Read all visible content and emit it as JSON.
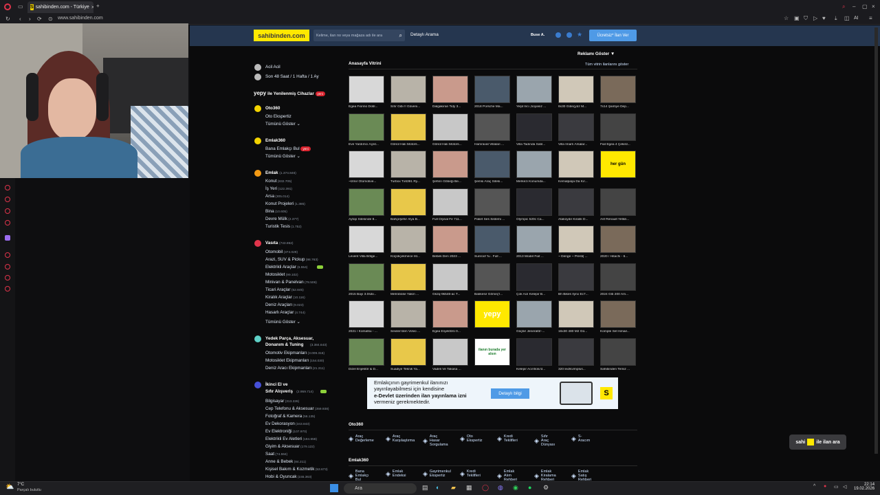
{
  "browser": {
    "tab_title": "sahibinden.com - Türkiye",
    "url": "www.sahibinden.com",
    "right_label": "AI"
  },
  "header": {
    "logo": "sahibinden.com",
    "search_placeholder": "Kelime, ilan no veya mağaza adı ile ara",
    "detailed_search": "Detaylı Arama",
    "user": "Buse A.",
    "post_ad": "Ücretsiz* İlan Ver"
  },
  "sidebar": {
    "acil": "Acil Acil",
    "son48": "Son 48 Saat",
    "haftalik": "1 Hafta",
    "aylik": "1 Ay",
    "yepy": "yepy",
    "yepy_text": "ile Yenilenmiş Cihazlar",
    "new_badge": "yeni",
    "oto360": "Oto360",
    "oto_ekspertiz": "Oto Ekspertiz",
    "tumunu": "Tümünü Göster",
    "emlak360": "Emlak360",
    "bana_emlakci": "Bana Emlakçı Bul",
    "emlak": {
      "title": "Emlak",
      "count": "(1.374.846)",
      "items": [
        {
          "n": "Konut",
          "c": "(832.705)"
        },
        {
          "n": "İş Yeri",
          "c": "(122.391)"
        },
        {
          "n": "Arsa",
          "c": "(305.014)"
        },
        {
          "n": "Konut Projeleri",
          "c": "(1.385)"
        },
        {
          "n": "Bina",
          "c": "(10.605)"
        },
        {
          "n": "Devre Mülk",
          "c": "(2.377)"
        },
        {
          "n": "Turistik Tesis",
          "c": "(1.752)"
        }
      ]
    },
    "vasita": {
      "title": "Vasıta",
      "count": "(743.862)",
      "items": [
        {
          "n": "Otomobil",
          "c": "(374.029)"
        },
        {
          "n": "Arazi, SUV & Pickup",
          "c": "(98.763)"
        },
        {
          "n": "Elektrikli Araçlar",
          "c": "(6.554)"
        },
        {
          "n": "Motosiklet",
          "c": "(99.102)"
        },
        {
          "n": "Minivan & Panelvan",
          "c": "(78.506)"
        },
        {
          "n": "Ticari Araçlar",
          "c": "(52.845)"
        },
        {
          "n": "Kiralık Araçlar",
          "c": "(10.116)"
        },
        {
          "n": "Deniz Araçları",
          "c": "(9.023)"
        },
        {
          "n": "Hasarlı Araçlar",
          "c": "(4.744)"
        }
      ]
    },
    "yedek": {
      "title": "Yedek Parça, Aksesuar, Donanım & Tuning",
      "count": "(3.384.643)",
      "items": [
        {
          "n": "Otomotiv Ekipmanları",
          "c": "(3.009.316)"
        },
        {
          "n": "Motosiklet Ekipmanları",
          "c": "(154.030)"
        },
        {
          "n": "Deniz Aracı Ekipmanları",
          "c": "(21.311)"
        }
      ]
    },
    "ikinci": {
      "title": "İkinci El ve",
      "title2": "Sıfır Alışveriş",
      "count": "(2.959.714)",
      "items": [
        {
          "n": "Bilgisayar",
          "c": "(313.226)"
        },
        {
          "n": "Cep Telefonu & Aksesuar",
          "c": "(359.938)"
        },
        {
          "n": "Fotoğraf & Kamera",
          "c": "(56.135)"
        },
        {
          "n": "Ev Dekorasyon",
          "c": "(343.843)"
        },
        {
          "n": "Ev Elektroniği",
          "c": "(107.970)"
        },
        {
          "n": "Elektrikli Ev Aletleri",
          "c": "(194.658)"
        },
        {
          "n": "Giyim & Aksesuar",
          "c": "(179.122)"
        },
        {
          "n": "Saat",
          "c": "(74.594)"
        },
        {
          "n": "Anne & Bebek",
          "c": "(84.211)"
        },
        {
          "n": "Kişisel Bakım & Kozmetik",
          "c": "(53.673)"
        },
        {
          "n": "Hobi & Oyuncak",
          "c": "(155.363)"
        }
      ]
    }
  },
  "showcase": {
    "ads_toggle": "Reklamı Göster ▼",
    "title": "Anasayfa Vitrini",
    "all_link": "Tüm vitrin ilanlarını göster",
    "items": [
      "Egea Fiorino Dobl...",
      "Sıfır Gibi !! Güveni...",
      "Dalgakıran Tidy 3...",
      "2018 Porsche Ma...",
      "Yeşil İnci ,boyasız ...",
      "8x30 Güleçyüz M...",
      "7x14 Şantiye Dep...",
      "Eve Yardımcı Açıkl...",
      "Gönül Halı Motors...",
      "Gönül Halı Motors...",
      "Hamravat Villaları ...",
      "Villa Tadında Satıl...",
      "Villa İmarlı Arsalar...",
      "Fiat Egea 4 Çekird...",
      "~Izmir Otomotive...",
      "Turbox Tx6391 Ry...",
      "Şehrin Göbeği Be...",
      "Şemsi Araç Sitesi...",
      "Merkezi Konumda...",
      "Kemalpaşa Da Kır...",
      "",
      "Aytop Sitesinde 8...",
      "Bahçeşehir Alya B...",
      "Full Orjinal Fe 711...",
      "Paket Ses Sistemi ...",
      "Olympic 520c Ca...",
      "Atakoyde Kiralık D...",
      "Asf Renault Yetkili...",
      "Levent Villa Bölge...",
      "Küçükçekmece İst...",
      "Bebek Den 2023 ...",
      "Sunroof 'lu . Full ...",
      "2013 Model Fiat ...",
      "~ Denge ~ Presti| ...",
      "2020 / Hitachi - 6...",
      "2015 Bayi 3.0sdv...",
      "Metrobüse Yakın ...",
      "Gk2q-9k546-ac T...",
      "Balıkesir Gömeç'l...",
      "Çok Acil Kelepir B...",
      "Bh Bikes Ilynx Ec7...",
      "2024 Glb 200 Am...",
      "2021 / Komatsu - ...",
      "Sevilen'den Volvo ...",
      "Egea Enjektörü 0...",
      "",
      "Güçbir Jeneratör-...",
      "16x30 480 M2 Gü...",
      "Komple Set İsmail...",
      "Dizel Enjektör & D...",
      "Suadiye Teknik Ya...",
      "Vadeli Ve Takasa ...",
      "",
      "Kelepir Acil Bolu'd...",
      "320 led/lci/mplus...",
      "Sahibinden Temiz ..."
    ],
    "special_tile": "her gün",
    "yepy_tile": "yepy",
    "ilan_tile": "ilanın burada yer alsın"
  },
  "banner": {
    "line1": "Emlakçının gayrimenkul ilanınızı",
    "line2": "yayınlayabilmesi için kendisine",
    "line3": "e-Devlet üzerinden ilan yayınlama izni",
    "line4": "vermeniz gerekmektedir.",
    "button": "Detaylı bilgi",
    "badge": "S"
  },
  "oto360": {
    "title": "Oto360",
    "links": [
      {
        "a": "Araç",
        "b": "Değerleme"
      },
      {
        "a": "Araç",
        "b": "Karşılaştırma"
      },
      {
        "a": "Araç Hasar",
        "b": "Sorgulama"
      },
      {
        "a": "Oto",
        "b": "Ekspertiz"
      },
      {
        "a": "Kredi",
        "b": "Teklifleri"
      },
      {
        "a": "Sıfır Araç",
        "b": "Dünyası"
      },
      {
        "a": "S-Aracım",
        "b": ""
      }
    ]
  },
  "emlak360": {
    "title": "Emlak360",
    "links": [
      {
        "a": "Bana",
        "b": "Emlakçı Bul"
      },
      {
        "a": "Emlak",
        "b": "Endeksi"
      },
      {
        "a": "Gayrimenkul",
        "b": "Ekspertiz"
      },
      {
        "a": "Kredi",
        "b": "Teklifleri"
      },
      {
        "a": "Emlak Alım",
        "b": "Rehberi"
      },
      {
        "a": "Emlak Kiralama",
        "b": "Rehberi"
      },
      {
        "a": "Emlak Satış",
        "b": "Rehberi"
      }
    ]
  },
  "float_search": {
    "a": "sahi",
    "b": "ile ilan ara"
  },
  "taskbar": {
    "weather_temp": "7°C",
    "weather_desc": "Parçalı bulutlu",
    "search": "Ara",
    "time": "22:14",
    "date": "19.02.2026"
  }
}
